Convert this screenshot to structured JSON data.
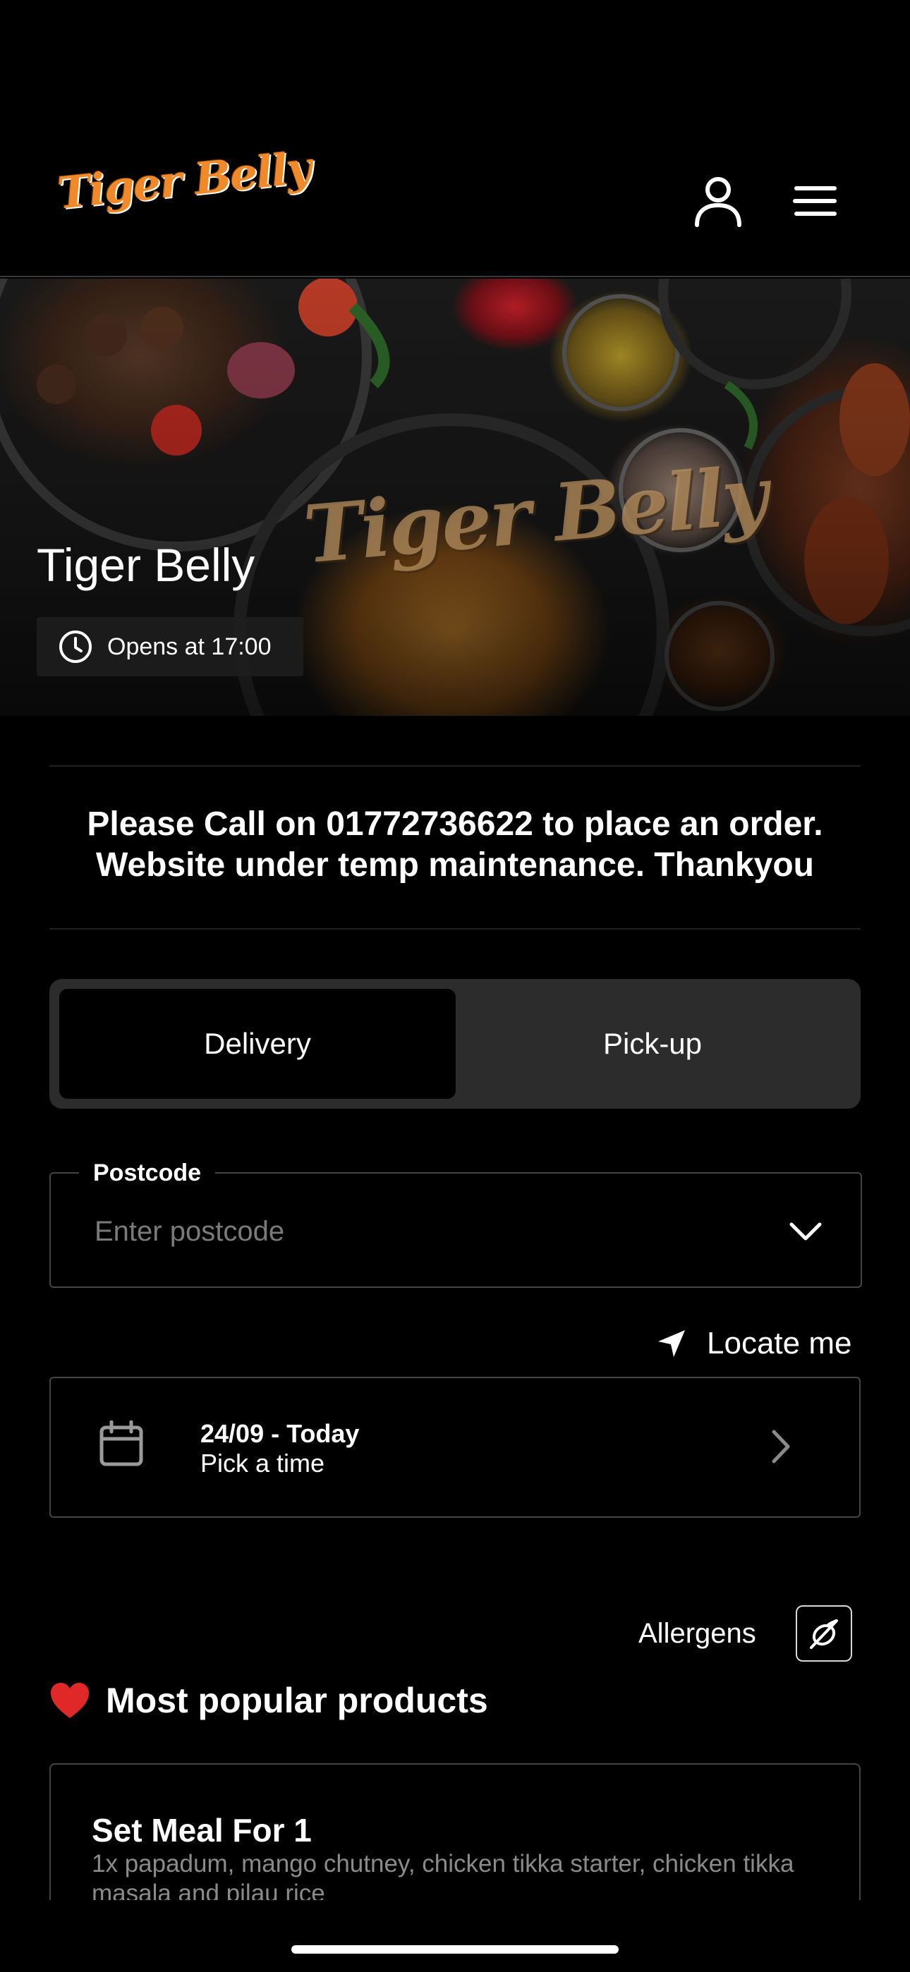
{
  "header": {
    "logo_text": "Tiger Belly",
    "account_icon": "user-icon",
    "menu_icon": "hamburger-menu-icon",
    "brand_color": "#f0892a"
  },
  "hero": {
    "watermark": "Tiger Belly",
    "title": "Tiger Belly",
    "status_icon": "clock-icon",
    "status_text": "Opens at 17:00"
  },
  "notice": {
    "line1": "Please Call on 01772736622 to place an order.",
    "line2": "Website under temp maintenance. Thankyou"
  },
  "order_mode": {
    "options": [
      "Delivery",
      "Pick-up"
    ],
    "selected": "Delivery"
  },
  "postcode": {
    "label": "Postcode",
    "placeholder": "Enter postcode",
    "value": ""
  },
  "locate": {
    "icon": "location-arrow-icon",
    "label": "Locate me"
  },
  "date_picker": {
    "icon": "calendar-icon",
    "date_label": "24/09 - Today",
    "time_label": "Pick a time"
  },
  "allergens": {
    "label": "Allergens",
    "icon": "allergens-icon"
  },
  "popular": {
    "emoji": "❤️",
    "title": "Most popular products",
    "products": [
      {
        "name": "Set Meal For 1",
        "description": "1x papadum, mango chutney, chicken tikka starter, chicken tikka masala and pilau rice"
      }
    ]
  }
}
